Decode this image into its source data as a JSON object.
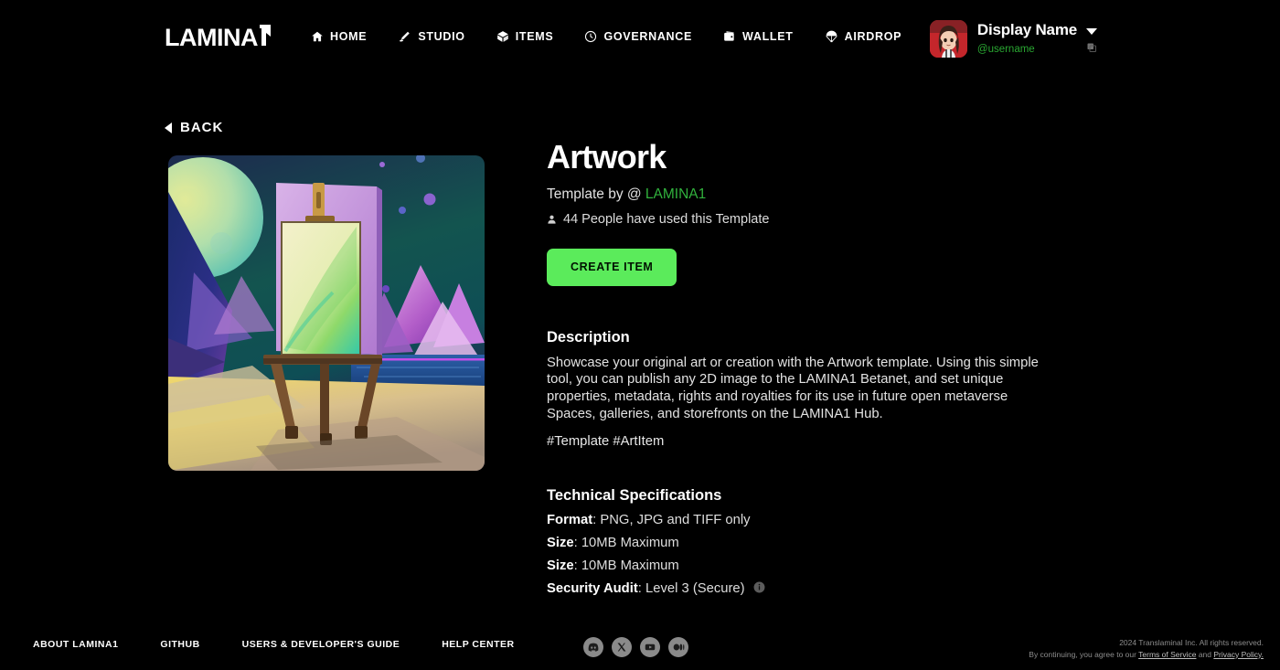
{
  "header": {
    "logo_text": "LAMINA",
    "logo_mark": "flag-one",
    "nav": [
      {
        "label": "HOME",
        "icon": "home-icon"
      },
      {
        "label": "STUDIO",
        "icon": "studio-icon"
      },
      {
        "label": "ITEMS",
        "icon": "cube-icon"
      },
      {
        "label": "GOVERNANCE",
        "icon": "clock-icon"
      },
      {
        "label": "WALLET",
        "icon": "wallet-icon"
      },
      {
        "label": "AIRDROP",
        "icon": "parachute-icon"
      }
    ],
    "profile": {
      "display_name": "Display Name",
      "username": "@username",
      "avatar": "anime-avatar",
      "caret": "chevron-down-icon",
      "copy": "copy-icon",
      "username_color": "#2aa832"
    }
  },
  "main": {
    "back_label": "BACK",
    "artwork_alt": "easel-surreal-landscape",
    "title": "Artwork",
    "subtitle_prefix": "Template by @ ",
    "subtitle_brand": "LAMINA1",
    "used_by": "44 People have used this Template",
    "used_by_icon": "person-icon",
    "cta_label": "CREATE ITEM",
    "cta_color": "#5beb5b",
    "description": {
      "heading": "Description",
      "body": "Showcase your original art or creation with the Artwork template. Using this simple tool, you can publish any 2D image to the LAMINA1 Betanet, and set unique properties, metadata, rights and royalties for its use in future open metaverse Spaces, galleries, and storefronts on the LAMINA1 Hub.",
      "tags": "#Template #ArtItem"
    },
    "specs": {
      "heading": "Technical Specifications",
      "rows": [
        {
          "key": "Format",
          "value": ": PNG, JPG and TIFF only",
          "info": false
        },
        {
          "key": "Size",
          "value": ": 10MB Maximum",
          "info": false
        },
        {
          "key": "Size",
          "value": ": 10MB Maximum",
          "info": false
        },
        {
          "key": "Security Audit",
          "value": ": Level 3 (Secure)",
          "info": true
        }
      ]
    }
  },
  "footer": {
    "links": [
      "ABOUT LAMINA1",
      "GITHUB",
      "USERS & DEVELOPER'S GUIDE",
      "HELP CENTER"
    ],
    "socials": [
      {
        "name": "discord-icon"
      },
      {
        "name": "x-twitter-icon"
      },
      {
        "name": "youtube-icon"
      },
      {
        "name": "medium-icon"
      }
    ],
    "copyright_line1": "2024 Translaminal Inc. All rights reserved.",
    "copyright_line2_pre": "By continuing, you agree to our ",
    "copyright_tos": "Terms of Service",
    "copyright_and": " and ",
    "copyright_privacy": "Privacy Policy."
  }
}
